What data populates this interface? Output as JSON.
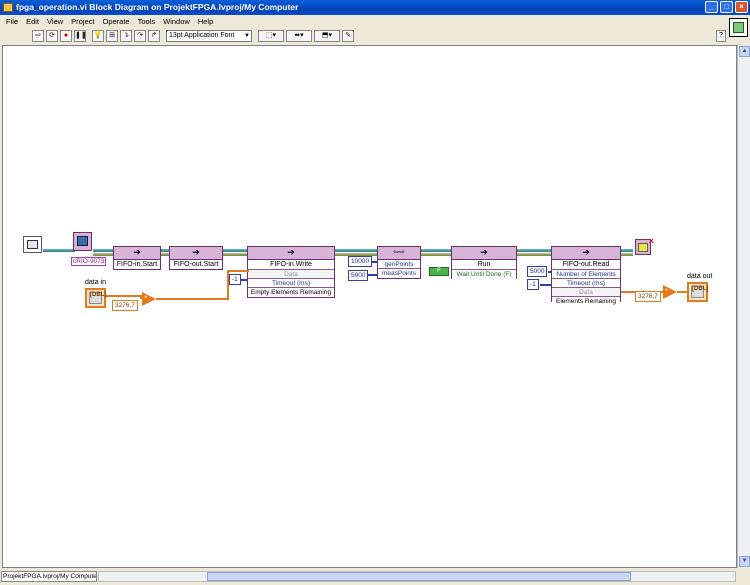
{
  "window": {
    "title": "fpga_operation.vi Block Diagram on ProjektFPGA.lvproj/My Computer",
    "controls": {
      "minimize": "_",
      "maximize": "□",
      "close": "×"
    }
  },
  "menu": [
    "File",
    "Edit",
    "View",
    "Project",
    "Operate",
    "Tools",
    "Window",
    "Help"
  ],
  "toolbar": {
    "buttons": [
      {
        "name": "run-arrow-button",
        "glyph": "⇨"
      },
      {
        "name": "run-continuously-button",
        "glyph": "⟳"
      },
      {
        "name": "abort-button",
        "glyph": "●"
      },
      {
        "name": "pause-button",
        "glyph": "❚❚"
      },
      {
        "name": "highlight-execution-button",
        "glyph": "💡"
      },
      {
        "name": "retain-wire-values-button",
        "glyph": "⊞"
      },
      {
        "name": "step-into-button",
        "glyph": "↴"
      },
      {
        "name": "step-over-button",
        "glyph": "↷"
      },
      {
        "name": "step-out-button",
        "glyph": "↱"
      }
    ],
    "font_select": "13pt Application Font",
    "align_glyph": "⬚▾",
    "distribute_glyph": "⬌▾",
    "reorder_glyph": "⬒▾",
    "cleanup_glyph": "✎",
    "help_glyph": "?"
  },
  "diagram": {
    "resource_label": "cRIO-9073",
    "invoke_nodes": {
      "fifo_in_start": {
        "label": "FIFO-in.Start"
      },
      "fifo_out_start": {
        "label": "FIFO-out.Start"
      },
      "fifo_in_write": {
        "label": "FIFO-in.Write",
        "rows": [
          "Data",
          "Timeout (ms)",
          "Empty Elements Remaining"
        ]
      },
      "props": {
        "label": "",
        "rows": [
          "genPoints",
          "measPoints"
        ]
      },
      "run": {
        "label": "Run",
        "rows": [
          "Wait Until Done (F)"
        ]
      },
      "fifo_out_read": {
        "label": "FIFO-out.Read",
        "rows": [
          "Number of Elements",
          "Timeout (ms)",
          "Data",
          "Elements Remaining"
        ]
      }
    },
    "constants": {
      "gen_points": "10000",
      "meas_points": "5000",
      "timeout_write": "-1",
      "num_elements": "5000",
      "timeout_read": "-1",
      "scale_in": "3276,7",
      "scale_out": "3276,7",
      "wait_bool": "F"
    },
    "terminals": {
      "data_in": {
        "label": "data in",
        "tag": "[DBL]"
      },
      "data_out": {
        "label": "data out",
        "tag": "[DBL]"
      }
    },
    "multiply_glyph": "×",
    "divide_glyph": "÷"
  },
  "status": {
    "path": "ProjektFPGA.lvproj/My Computer"
  }
}
